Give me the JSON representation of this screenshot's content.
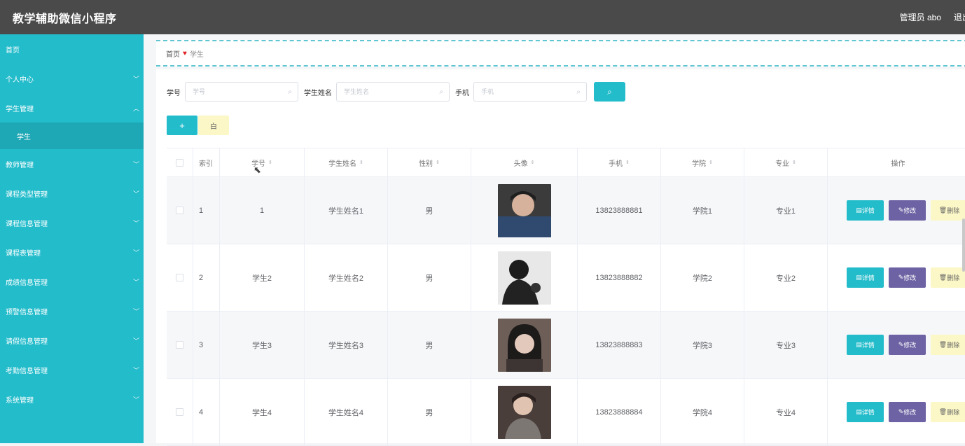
{
  "app": {
    "title": "教学辅助微信小程序"
  },
  "topbar": {
    "admin": "管理员 abo",
    "logout": "退出"
  },
  "sidebar": {
    "home": "首页",
    "items": [
      {
        "label": "个人中心"
      },
      {
        "label": "学生管理",
        "expanded": true,
        "children": [
          "学生"
        ]
      },
      {
        "label": "教师管理"
      },
      {
        "label": "课程类型管理"
      },
      {
        "label": "课程信息管理"
      },
      {
        "label": "课程表管理"
      },
      {
        "label": "成绩信息管理"
      },
      {
        "label": "预警信息管理"
      },
      {
        "label": "请假信息管理"
      },
      {
        "label": "考勤信息管理"
      },
      {
        "label": "系统管理"
      }
    ]
  },
  "breadcrumb": {
    "home": "首页",
    "separator": "♥",
    "current": "学生"
  },
  "search": {
    "fields": [
      {
        "label": "学号",
        "placeholder": "学号"
      },
      {
        "label": "学生姓名",
        "placeholder": "学生姓名"
      },
      {
        "label": "手机",
        "placeholder": "手机"
      }
    ]
  },
  "actions": {
    "add": "+",
    "delete": "白"
  },
  "table": {
    "headers": [
      "索引",
      "学号",
      "学生姓名",
      "性别",
      "头像",
      "手机",
      "学院",
      "专业",
      "操作"
    ],
    "rows": [
      {
        "index": "1",
        "id": "1",
        "name": "学生姓名1",
        "gender": "男",
        "phone": "13823888881",
        "college": "学院1",
        "major": "专业1",
        "avatar_color": "#2f4a6e"
      },
      {
        "index": "2",
        "id": "学生2",
        "name": "学生姓名2",
        "gender": "男",
        "phone": "13823888882",
        "college": "学院2",
        "major": "专业2",
        "avatar_color": "#2b2b2b"
      },
      {
        "index": "3",
        "id": "学生3",
        "name": "学生姓名3",
        "gender": "男",
        "phone": "13823888883",
        "college": "学院3",
        "major": "专业3",
        "avatar_color": "#5a4a44"
      },
      {
        "index": "4",
        "id": "学生4",
        "name": "学生姓名4",
        "gender": "男",
        "phone": "13823888884",
        "college": "学院4",
        "major": "专业4",
        "avatar_color": "#4a3e3a"
      }
    ],
    "row_actions": {
      "detail": "详情",
      "edit": "修改",
      "delete": "删除"
    }
  },
  "colors": {
    "accent": "#23bccb",
    "topbar": "#4a4a4a",
    "edit": "#6d62a3",
    "delete_bg": "#fbf7c6"
  }
}
